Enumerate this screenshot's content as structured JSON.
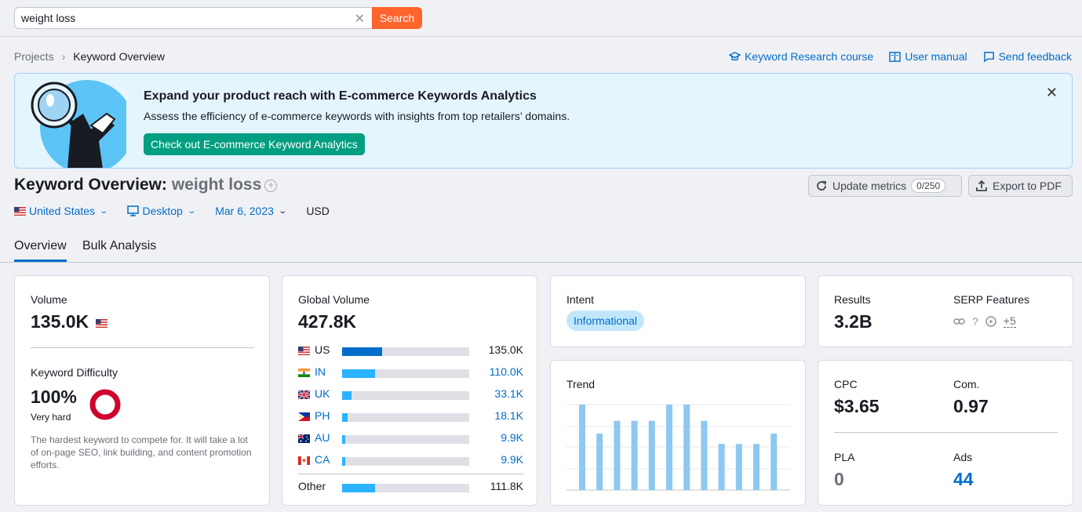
{
  "search": {
    "value": "weight loss",
    "button": "Search"
  },
  "breadcrumb": {
    "root": "Projects",
    "current": "Keyword Overview"
  },
  "toplinks": {
    "course": "Keyword Research course",
    "manual": "User manual",
    "feedback": "Send feedback"
  },
  "banner": {
    "title": "Expand your product reach with E-commerce Keywords Analytics",
    "subtitle": "Assess the efficiency of e-commerce keywords with insights from top retailers’ domains.",
    "button": "Check out E-commerce Keyword Analytics"
  },
  "header": {
    "title": "Keyword Overview:",
    "keyword": "weight loss",
    "update_label": "Update metrics",
    "update_counter": "0/250",
    "export_label": "Export to PDF"
  },
  "filters": {
    "country": "United States",
    "device": "Desktop",
    "date": "Mar 6, 2023",
    "currency": "USD"
  },
  "tabs": [
    "Overview",
    "Bulk Analysis"
  ],
  "volume": {
    "label": "Volume",
    "value": "135.0K"
  },
  "difficulty": {
    "label": "Keyword Difficulty",
    "value": "100%",
    "level": "Very hard",
    "description": "The hardest keyword to compete for. It will take a lot of on-page SEO, link building, and content promotion efforts.",
    "color": "#d1002f"
  },
  "global_volume": {
    "label": "Global Volume",
    "value": "427.8K",
    "rows": [
      {
        "code": "US",
        "value": "135.0K",
        "fraction": 0.315,
        "color": "#006dca",
        "link": false
      },
      {
        "code": "IN",
        "value": "110.0K",
        "fraction": 0.257,
        "color": "#2bb3ff",
        "link": true
      },
      {
        "code": "UK",
        "value": "33.1K",
        "fraction": 0.077,
        "color": "#2bb3ff",
        "link": true
      },
      {
        "code": "PH",
        "value": "18.1K",
        "fraction": 0.042,
        "color": "#2bb3ff",
        "link": true
      },
      {
        "code": "AU",
        "value": "9.9K",
        "fraction": 0.023,
        "color": "#2bb3ff",
        "link": true
      },
      {
        "code": "CA",
        "value": "9.9K",
        "fraction": 0.023,
        "color": "#2bb3ff",
        "link": true
      }
    ],
    "other": {
      "label": "Other",
      "value": "111.8K",
      "fraction": 0.261
    }
  },
  "intent": {
    "label": "Intent",
    "value": "Informational"
  },
  "results": {
    "label": "Results",
    "value": "3.2B"
  },
  "serp": {
    "label": "SERP Features",
    "icons": [
      "link-icon",
      "question-icon",
      "video-icon"
    ],
    "more": "+5"
  },
  "trend": {
    "label": "Trend",
    "values": [
      1.0,
      0.66,
      0.81,
      0.81,
      0.81,
      1.0,
      1.0,
      0.81,
      0.54,
      0.54,
      0.54,
      0.66
    ],
    "color": "#8dc8f1"
  },
  "cpc": {
    "label": "CPC",
    "value": "$3.65"
  },
  "com": {
    "label": "Com.",
    "value": "0.97"
  },
  "pla": {
    "label": "PLA",
    "value": "0"
  },
  "ads": {
    "label": "Ads",
    "value": "44"
  }
}
